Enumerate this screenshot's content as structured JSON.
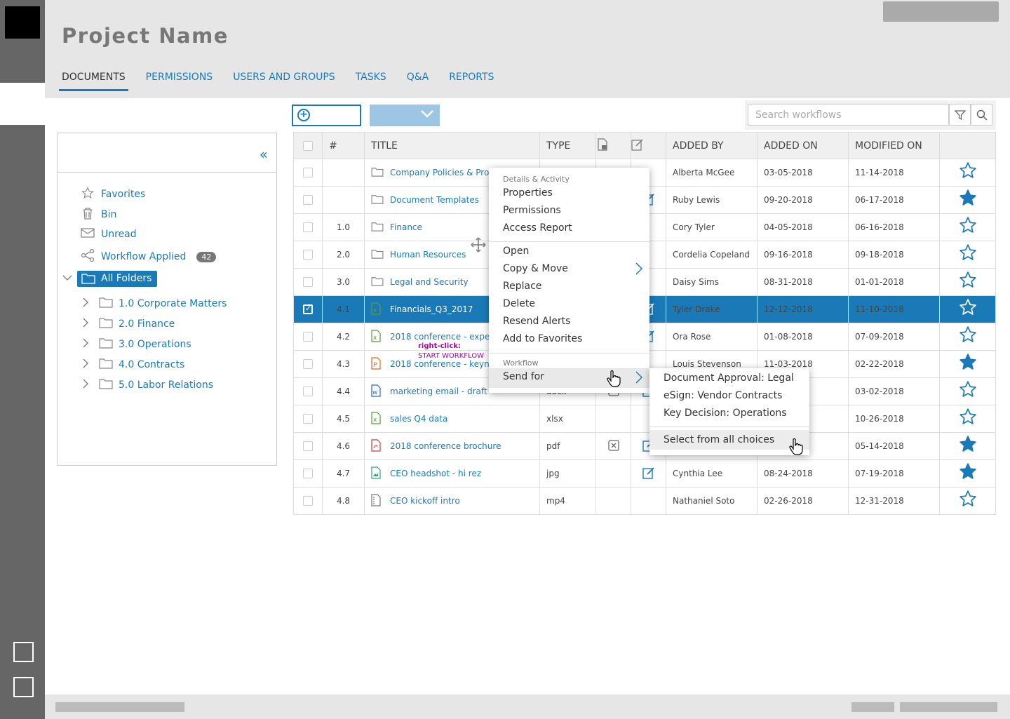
{
  "header": {
    "title": "Project Name",
    "tabs": [
      {
        "label": "DOCUMENTS",
        "active": true
      },
      {
        "label": "PERMISSIONS"
      },
      {
        "label": "USERS AND GROUPS"
      },
      {
        "label": "TASKS"
      },
      {
        "label": "Q&A"
      },
      {
        "label": "REPORTS"
      }
    ]
  },
  "sidebar": {
    "quick_links": [
      {
        "label": "Favorites",
        "icon": "star-icon"
      },
      {
        "label": "Bin",
        "icon": "trash-icon"
      },
      {
        "label": "Unread",
        "icon": "envelope-icon"
      },
      {
        "label": "Workflow Applied",
        "icon": "share-icon",
        "badge": "42"
      }
    ],
    "all_folders": "All Folders",
    "folders": [
      "1.0 Corporate Matters",
      "2.0 Finance",
      "3.0 Operations",
      "4.0 Contracts",
      "5.0 Labor Relations"
    ]
  },
  "search": {
    "placeholder": "Search workflows"
  },
  "table": {
    "headers": {
      "num": "#",
      "title": "TITLE",
      "type": "TYPE",
      "added_by": "ADDED BY",
      "added_on": "ADDED ON",
      "modified_on": "MODIFIED ON"
    },
    "rows": [
      {
        "num": "",
        "title": "Company Policies & Procedures",
        "type": "",
        "icon": "folder",
        "added_by": "Alberta McGee",
        "added_on": "03-05-2018",
        "modified_on": "11-14-2018",
        "fav": false
      },
      {
        "num": "",
        "title": "Document Templates",
        "type": "",
        "icon": "folder",
        "added_by": "Ruby Lewis",
        "added_on": "09-20-2018",
        "modified_on": "06-17-2018",
        "fav": true
      },
      {
        "num": "1.0",
        "title": "Finance",
        "type": "",
        "icon": "folder",
        "added_by": "Cory Tyler",
        "added_on": "04-05-2018",
        "modified_on": "06-16-2018",
        "fav": false
      },
      {
        "num": "2.0",
        "title": "Human Resources",
        "type": "",
        "icon": "folder",
        "added_by": "Cordelia Copeland",
        "added_on": "09-16-2018",
        "modified_on": "09-18-2018",
        "fav": false
      },
      {
        "num": "3.0",
        "title": "Legal and Security",
        "type": "",
        "icon": "folder",
        "added_by": "Daisy Sims",
        "added_on": "08-31-2018",
        "modified_on": "01-01-2018",
        "fav": false
      },
      {
        "num": "4.1",
        "title": "Financials_Q3_2017",
        "type": "",
        "icon": "xls",
        "added_by": "Tyler Drake",
        "added_on": "12-12-2018",
        "modified_on": "11-10-2018",
        "fav": false,
        "selected": true
      },
      {
        "num": "4.2",
        "title": "2018 conference - expenses",
        "type": "",
        "icon": "xls",
        "added_by": "Ora Rose",
        "added_on": "01-08-2018",
        "modified_on": "07-09-2018",
        "fav": false
      },
      {
        "num": "4.3",
        "title": "2018 conference - keynote",
        "type": "",
        "icon": "ppt",
        "added_by": "Louis Stevenson",
        "added_on": "11-03-2018",
        "modified_on": "02-22-2018",
        "fav": true
      },
      {
        "num": "4.4",
        "title": "marketing email - draft",
        "type": "docx",
        "icon": "doc",
        "added_by": "",
        "added_on": "",
        "modified_on": "03-02-2018",
        "fav": false
      },
      {
        "num": "4.5",
        "title": "sales Q4 data",
        "type": "xlsx",
        "icon": "xls",
        "added_by": "",
        "added_on": "",
        "modified_on": "10-26-2018",
        "fav": false
      },
      {
        "num": "4.6",
        "title": "2018 conference brochure",
        "type": "pdf",
        "icon": "pdf",
        "added_by": "",
        "added_on": "",
        "modified_on": "05-14-2018",
        "fav": true
      },
      {
        "num": "4.7",
        "title": "CEO headshot - hi rez",
        "type": "jpg",
        "icon": "img",
        "added_by": "Cynthia Lee",
        "added_on": "08-24-2018",
        "modified_on": "07-19-2018",
        "fav": true
      },
      {
        "num": "4.8",
        "title": "CEO kickoff intro",
        "type": "mp4",
        "icon": "vid",
        "added_by": "Nathaniel Soto",
        "added_on": "02-26-2018",
        "modified_on": "12-31-2018",
        "fav": false
      }
    ]
  },
  "annotation": {
    "line1": "right-click:",
    "line2": "START WORKFLOW"
  },
  "context_menu": {
    "group1": "Details & Activity",
    "properties": "Properties",
    "permissions": "Permissions",
    "access_report": "Access Report",
    "open": "Open",
    "copy_move": "Copy & Move",
    "replace": "Replace",
    "delete": "Delete",
    "resend_alerts": "Resend Alerts",
    "add_favorites": "Add to Favorites",
    "group2": "Workflow",
    "send_for": "Send for"
  },
  "submenu": {
    "items": [
      "Document Approval: Legal",
      "eSign: Vendor Contracts",
      "Key Decision: Operations"
    ],
    "all": "Select from all choices"
  },
  "colors": {
    "accent": "#1a7ab8",
    "header_bg": "#e6e6e6",
    "rail": "#666666"
  }
}
